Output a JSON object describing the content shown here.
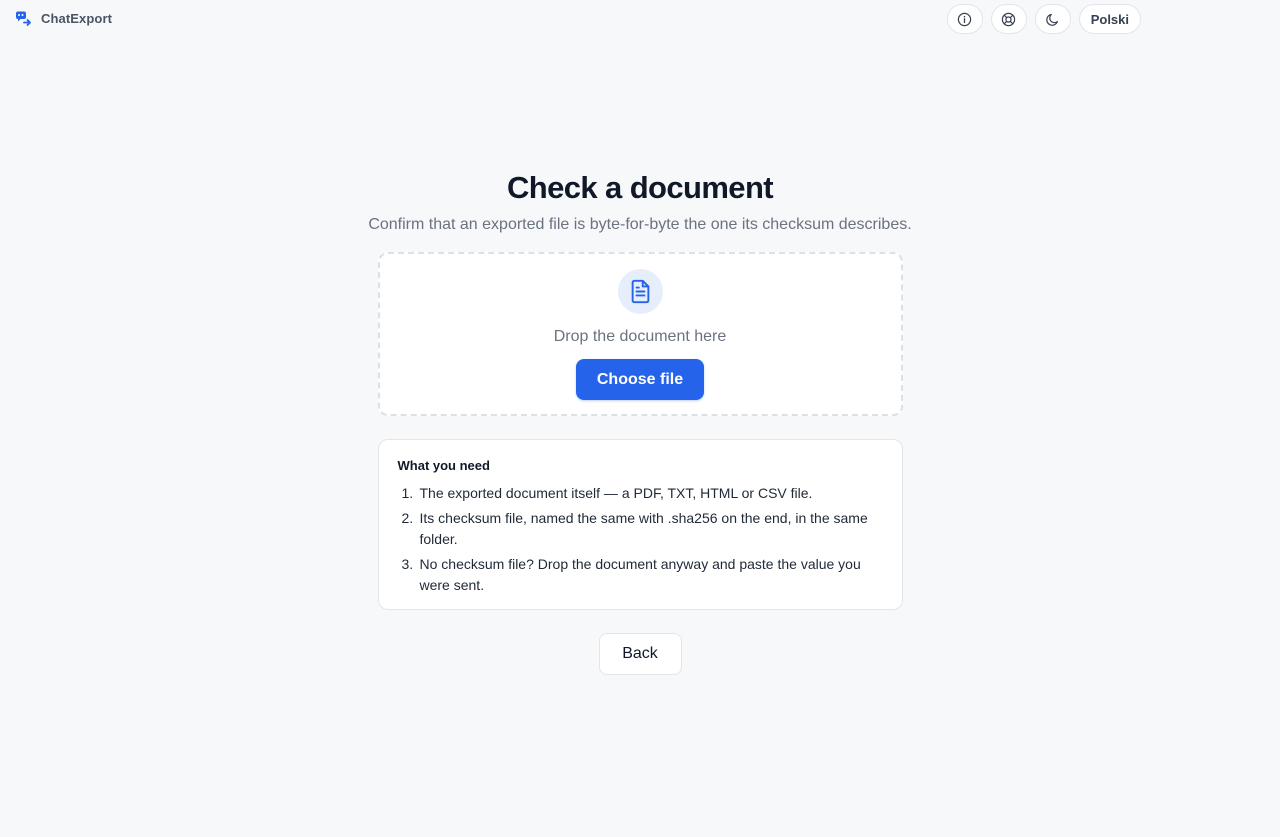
{
  "app": {
    "name": "ChatExport"
  },
  "header": {
    "info_icon": "info-icon",
    "help_icon": "lifebuoy-icon",
    "theme_icon": "moon-icon",
    "language_label": "Polski"
  },
  "main": {
    "title": "Check a document",
    "subtitle": "Confirm that an exported file is byte-for-byte the one its checksum describes.",
    "dropzone": {
      "icon": "document-icon",
      "text": "Drop the document here",
      "button_label": "Choose file"
    },
    "needs": {
      "title": "What you need",
      "items": [
        {
          "num": "1.",
          "text": "The exported document itself — a PDF, TXT, HTML or CSV file."
        },
        {
          "num": "2.",
          "text": "Its checksum file, named the same with .sha256 on the end, in the same folder."
        },
        {
          "num": "3.",
          "text": "No checksum file? Drop the document anyway and paste the value you were sent."
        }
      ]
    },
    "back_label": "Back"
  },
  "colors": {
    "accent": "#2563eb",
    "background": "#f7f8fa",
    "muted_text": "#6b7280"
  }
}
